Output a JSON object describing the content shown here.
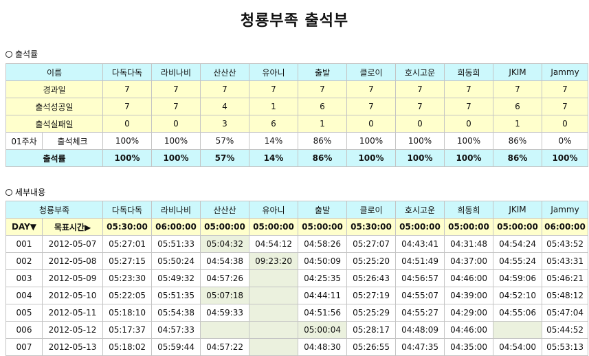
{
  "title": "청룡부족 출석부",
  "section1": {
    "title": "출석률",
    "header_label": "이름",
    "names": [
      "다독다독",
      "라비나비",
      "산산산",
      "유아니",
      "출발",
      "클로이",
      "호시고운",
      "희동희",
      "JKIM",
      "Jammy"
    ],
    "rows": [
      {
        "label": "경과일",
        "values": [
          "7",
          "7",
          "7",
          "7",
          "7",
          "7",
          "7",
          "7",
          "7",
          "7"
        ]
      },
      {
        "label": "출석성공일",
        "values": [
          "7",
          "7",
          "4",
          "1",
          "6",
          "7",
          "7",
          "7",
          "6",
          "7"
        ]
      },
      {
        "label": "출석실패일",
        "values": [
          "0",
          "0",
          "3",
          "6",
          "1",
          "0",
          "0",
          "0",
          "1",
          "0"
        ]
      }
    ],
    "week_row": {
      "week": "01주차",
      "label": "출석체크",
      "values": [
        "100%",
        "100%",
        "57%",
        "14%",
        "86%",
        "100%",
        "100%",
        "100%",
        "86%",
        "0%"
      ]
    },
    "rate_row": {
      "label": "출석률",
      "values": [
        "100%",
        "100%",
        "57%",
        "14%",
        "86%",
        "100%",
        "100%",
        "100%",
        "86%",
        "100%"
      ]
    }
  },
  "section2": {
    "title": "세부내용",
    "header_label": "청룡부족",
    "names": [
      "다독다독",
      "라비나비",
      "산산산",
      "유아니",
      "출발",
      "클로이",
      "호시고운",
      "희동희",
      "JKIM",
      "Jammy"
    ],
    "day_label": "DAY▼",
    "target_label": "목표시간▶",
    "targets": [
      "05:30:00",
      "06:00:00",
      "05:00:00",
      "05:00:00",
      "05:00:00",
      "05:30:00",
      "05:00:00",
      "05:00:00",
      "05:00:00",
      "06:00:00"
    ],
    "rows": [
      {
        "day": "001",
        "date": "2012-05-07",
        "times": [
          "05:27:01",
          "05:51:33",
          "05:04:32",
          "04:54:12",
          "04:58:26",
          "05:27:07",
          "04:43:41",
          "04:31:48",
          "04:54:24",
          "05:43:52"
        ],
        "hl": [
          2
        ]
      },
      {
        "day": "002",
        "date": "2012-05-08",
        "times": [
          "05:27:15",
          "05:50:24",
          "04:54:38",
          "09:23:20",
          "04:50:09",
          "05:25:20",
          "04:51:49",
          "04:37:00",
          "04:55:24",
          "05:43:31"
        ],
        "hl": [
          3
        ]
      },
      {
        "day": "003",
        "date": "2012-05-09",
        "times": [
          "05:23:30",
          "05:49:32",
          "04:57:26",
          "",
          "04:25:35",
          "05:26:43",
          "04:56:57",
          "04:46:00",
          "04:59:06",
          "05:46:21"
        ],
        "hl": [
          3
        ]
      },
      {
        "day": "004",
        "date": "2012-05-10",
        "times": [
          "05:22:05",
          "05:51:35",
          "05:07:18",
          "",
          "04:44:11",
          "05:27:19",
          "04:55:07",
          "04:39:00",
          "04:52:10",
          "05:48:12"
        ],
        "hl": [
          2,
          3
        ]
      },
      {
        "day": "005",
        "date": "2012-05-11",
        "times": [
          "05:18:10",
          "05:54:38",
          "04:59:33",
          "",
          "04:51:56",
          "05:25:29",
          "04:55:27",
          "04:29:00",
          "04:55:06",
          "05:47:04"
        ],
        "hl": [
          3
        ]
      },
      {
        "day": "006",
        "date": "2012-05-12",
        "times": [
          "05:17:37",
          "04:57:33",
          "",
          "",
          "05:00:04",
          "05:28:17",
          "04:48:09",
          "04:46:00",
          "",
          "05:44:52"
        ],
        "hl": [
          2,
          3,
          4,
          8
        ]
      },
      {
        "day": "007",
        "date": "2012-05-13",
        "times": [
          "05:18:02",
          "05:59:44",
          "04:57:22",
          "",
          "04:48:30",
          "05:26:55",
          "04:47:35",
          "04:35:00",
          "04:54:00",
          "05:53:13"
        ],
        "hl": [
          3
        ]
      }
    ]
  }
}
